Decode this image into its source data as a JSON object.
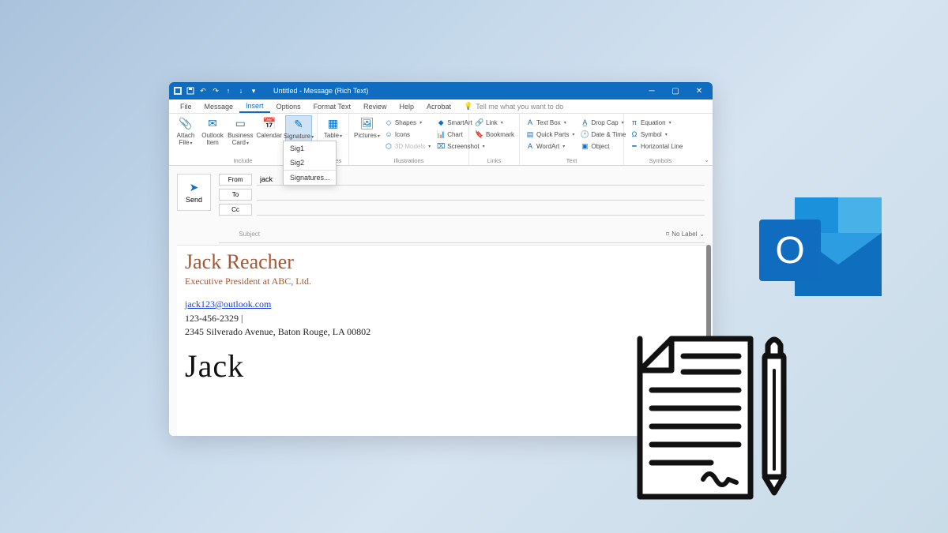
{
  "titlebar": {
    "title": "Untitled - Message (Rich Text)"
  },
  "menu": {
    "items": [
      "File",
      "Message",
      "Insert",
      "Options",
      "Format Text",
      "Review",
      "Help",
      "Acrobat"
    ],
    "active": "Insert",
    "tell_me": "Tell me what you want to do"
  },
  "ribbon": {
    "include": {
      "label": "Include",
      "attach_file": "Attach File",
      "outlook_item": "Outlook Item",
      "business_card": "Business Card",
      "calendar": "Calendar",
      "signature": "Signature"
    },
    "tables": {
      "label": "Tables",
      "table": "Table"
    },
    "illustrations": {
      "label": "Illustrations",
      "pictures": "Pictures",
      "shapes": "Shapes",
      "icons": "Icons",
      "models": "3D Models",
      "smartart": "SmartArt",
      "chart": "Chart",
      "screenshot": "Screenshot"
    },
    "links": {
      "label": "Links",
      "link": "Link",
      "bookmark": "Bookmark"
    },
    "text": {
      "label": "Text",
      "text_box": "Text Box",
      "quick_parts": "Quick Parts",
      "wordart": "WordArt",
      "drop_cap": "Drop Cap",
      "date_time": "Date & Time",
      "object": "Object"
    },
    "symbols": {
      "label": "Symbols",
      "equation": "Equation",
      "symbol": "Symbol",
      "horizontal_line": "Horizontal Line"
    }
  },
  "signature_menu": {
    "items": [
      "Sig1",
      "Sig2",
      "Signatures..."
    ]
  },
  "compose": {
    "send": "Send",
    "from": "From",
    "from_value": "jack",
    "to": "To",
    "cc": "Cc",
    "subject_label": "Subject",
    "no_label": "No Label"
  },
  "signature_body": {
    "name": "Jack Reacher",
    "title": "Executive President at ABC, Ltd.",
    "email": "jack123@outlook.com",
    "phone": "123-456-2329",
    "address": "2345 Silverado Avenue, Baton Rouge, LA 00802",
    "script": "Jack"
  },
  "outlook_logo": {
    "letter": "O"
  }
}
